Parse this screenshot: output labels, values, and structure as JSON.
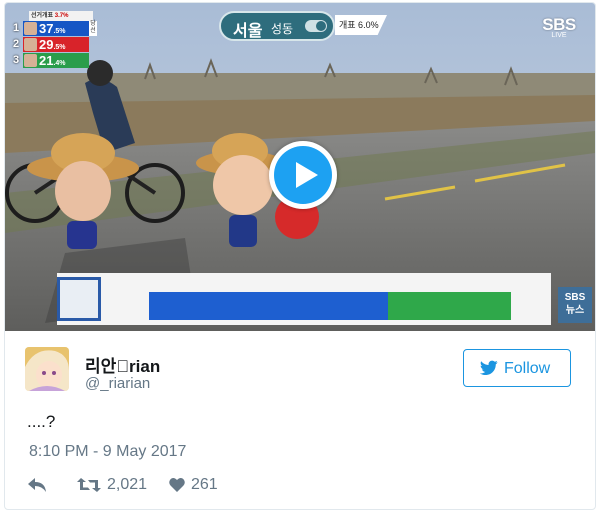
{
  "video": {
    "poll": {
      "header_prefix": "선거개표",
      "header_value": "3.7%",
      "rows": [
        {
          "rank": "1",
          "pct": "37",
          "pct_small": ".5%",
          "color": "#1556c5",
          "tag": "당선"
        },
        {
          "rank": "2",
          "pct": "29",
          "pct_small": ".5%",
          "color": "#d8232a",
          "tag": ""
        },
        {
          "rank": "3",
          "pct": "21",
          "pct_small": ".4%",
          "color": "#2a9d4b",
          "tag": ""
        }
      ]
    },
    "region": {
      "city": "서울",
      "district": "성동"
    },
    "counting_text": "개표 6.0%",
    "logo": {
      "name": "SBS",
      "sub": "LIVE"
    },
    "progress": {
      "blue_fraction": 0.66,
      "green_fraction": 0.34
    },
    "news_badge": {
      "line1": "SBS",
      "line2": "뉴스"
    },
    "play_icon": "play-button-icon",
    "colors": {
      "region": "#2e6d7d",
      "progress_blue": "#1e5fd0",
      "progress_green": "#2fa84a"
    }
  },
  "tweet": {
    "display_name": "리안\u0000rian",
    "handle": "@_riarian",
    "follow_label": "Follow",
    "text": "....?",
    "timestamp": "8:10 PM - 9 May 2017",
    "retweets": "2,021",
    "likes": "261",
    "icons": {
      "reply": "reply-icon",
      "retweet": "retweet-icon",
      "like": "heart-icon",
      "follow": "twitter-bird-icon"
    },
    "colors": {
      "twitter_blue": "#1b95e0",
      "muted": "#657786"
    }
  }
}
